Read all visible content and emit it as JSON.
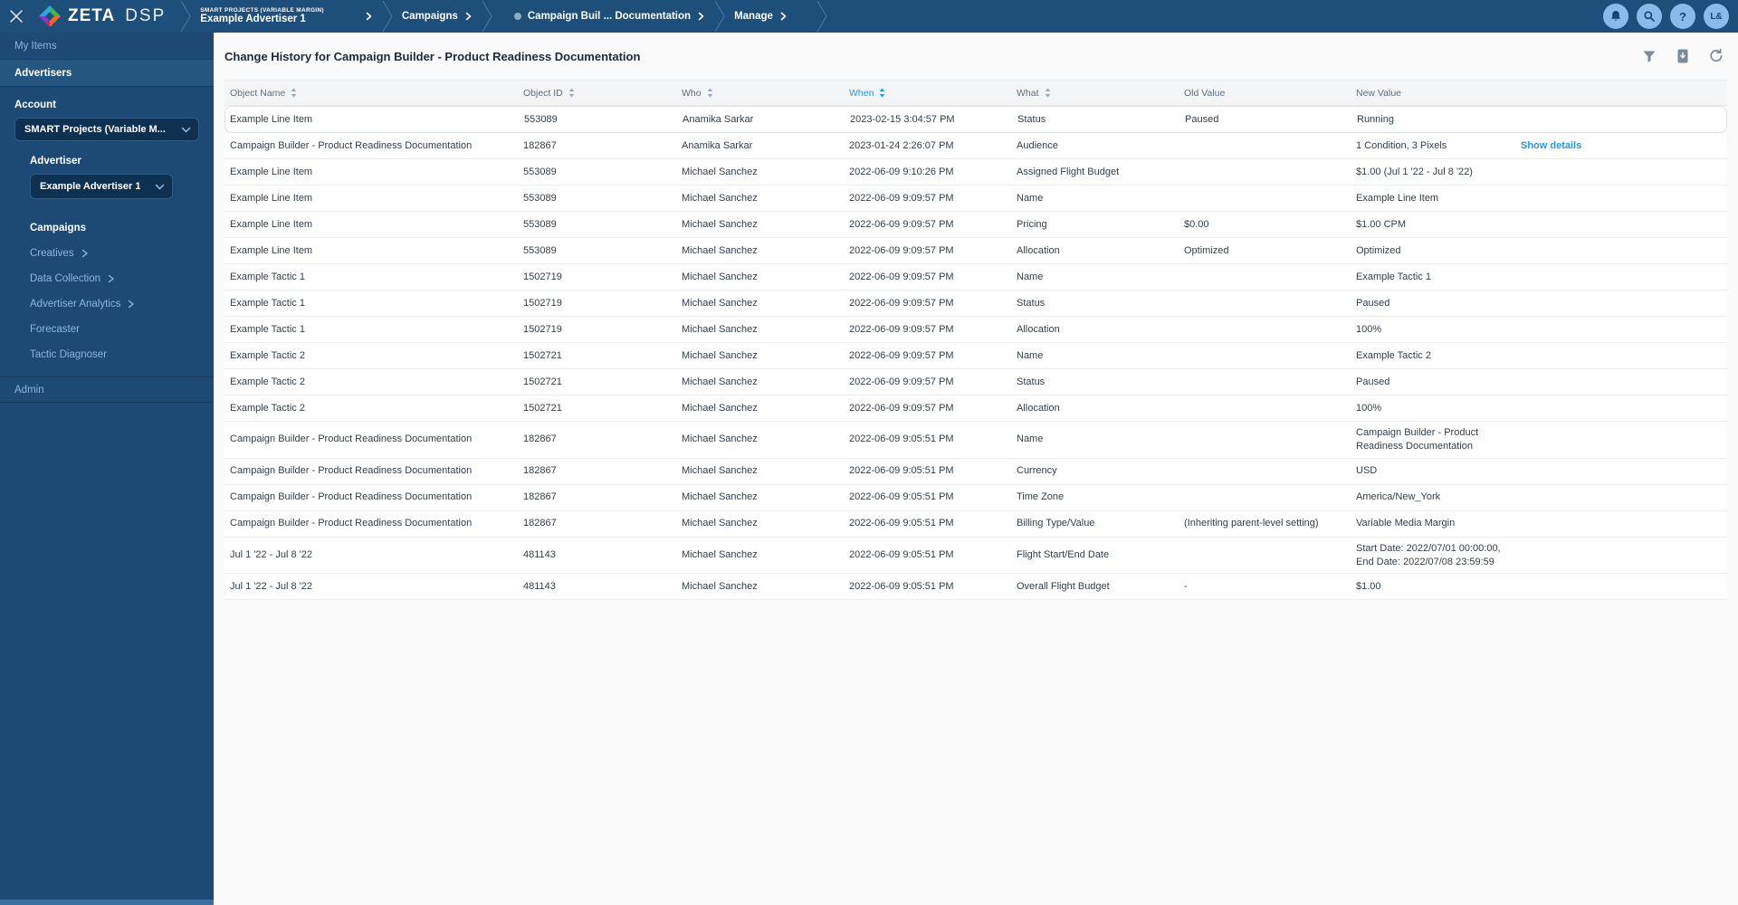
{
  "colors": {
    "accent": "#2196f3",
    "topbar": "#1e4e7a",
    "sidebar": "#1c4a75",
    "icon_gray": "#7d8b99",
    "circle_bg": "#8abae9"
  },
  "topbar": {
    "brand_zeta": "ZETA",
    "brand_dsp": "DSP",
    "breadcrumbs": {
      "account_small": "SMART PROJECTS (VARIABLE MARGIN)",
      "advertiser": "Example Advertiser 1",
      "campaigns": "Campaigns",
      "campaign": "Campaign Buil ... Documentation",
      "manage": "Manage"
    },
    "icons": [
      "bell-icon",
      "search-icon",
      "help-icon",
      "avatar"
    ],
    "avatar_initials": "L&"
  },
  "sidebar": {
    "my_items": "My Items",
    "advertisers": "Advertisers",
    "account_label": "Account",
    "account_value": "SMART Projects (Variable M...",
    "advertiser_label": "Advertiser",
    "advertiser_value": "Example Advertiser 1",
    "nav": [
      {
        "label": "Campaigns",
        "active": true,
        "arrow": false
      },
      {
        "label": "Creatives",
        "active": false,
        "arrow": true
      },
      {
        "label": "Data Collection",
        "active": false,
        "arrow": true
      },
      {
        "label": "Advertiser Analytics",
        "active": false,
        "arrow": true
      },
      {
        "label": "Forecaster",
        "active": false,
        "arrow": false
      },
      {
        "label": "Tactic Diagnoser",
        "active": false,
        "arrow": false
      }
    ],
    "admin": "Admin"
  },
  "main": {
    "title": "Change History for Campaign Builder - Product Readiness Documentation",
    "toolbar_icons": [
      "filter-icon",
      "export-icon",
      "refresh-icon"
    ],
    "table": {
      "columns": [
        {
          "key": "object_name",
          "label": "Object Name",
          "sortable": true,
          "active": false
        },
        {
          "key": "object_id",
          "label": "Object ID",
          "sortable": true,
          "active": false
        },
        {
          "key": "who",
          "label": "Who",
          "sortable": true,
          "active": false
        },
        {
          "key": "when",
          "label": "When",
          "sortable": true,
          "active": true
        },
        {
          "key": "what",
          "label": "What",
          "sortable": true,
          "active": false
        },
        {
          "key": "old_value",
          "label": "Old Value",
          "sortable": false,
          "active": false
        },
        {
          "key": "new_value",
          "label": "New Value",
          "sortable": false,
          "active": false
        }
      ],
      "details_link_label": "Show details",
      "rows": [
        {
          "object_name": "Example Line Item",
          "object_id": "553089",
          "who": "Anamika Sarkar",
          "when": "2023-02-15 3:04:57 PM",
          "what": "Status",
          "old_value": "Paused",
          "new_value": "Running",
          "details": false,
          "highlighted": true
        },
        {
          "object_name": "Campaign Builder - Product Readiness Documentation",
          "object_id": "182867",
          "who": "Anamika Sarkar",
          "when": "2023-01-24 2:26:07 PM",
          "what": "Audience",
          "old_value": "",
          "new_value": "1 Condition, 3 Pixels",
          "details": true,
          "highlighted": false
        },
        {
          "object_name": "Example Line Item",
          "object_id": "553089",
          "who": "Michael Sanchez",
          "when": "2022-06-09 9:10:26 PM",
          "what": "Assigned Flight Budget",
          "old_value": "",
          "new_value": "$1.00 (Jul 1 '22 - Jul 8 '22)",
          "details": false,
          "highlighted": false
        },
        {
          "object_name": "Example Line Item",
          "object_id": "553089",
          "who": "Michael Sanchez",
          "when": "2022-06-09 9:09:57 PM",
          "what": "Name",
          "old_value": "",
          "new_value": "Example Line Item",
          "details": false,
          "highlighted": false
        },
        {
          "object_name": "Example Line Item",
          "object_id": "553089",
          "who": "Michael Sanchez",
          "when": "2022-06-09 9:09:57 PM",
          "what": "Pricing",
          "old_value": "$0.00",
          "new_value": "$1.00 CPM",
          "details": false,
          "highlighted": false
        },
        {
          "object_name": "Example Line Item",
          "object_id": "553089",
          "who": "Michael Sanchez",
          "when": "2022-06-09 9:09:57 PM",
          "what": "Allocation",
          "old_value": "Optimized",
          "new_value": "Optimized",
          "details": false,
          "highlighted": false
        },
        {
          "object_name": "Example Tactic 1",
          "object_id": "1502719",
          "who": "Michael Sanchez",
          "when": "2022-06-09 9:09:57 PM",
          "what": "Name",
          "old_value": "",
          "new_value": "Example Tactic 1",
          "details": false,
          "highlighted": false
        },
        {
          "object_name": "Example Tactic 1",
          "object_id": "1502719",
          "who": "Michael Sanchez",
          "when": "2022-06-09 9:09:57 PM",
          "what": "Status",
          "old_value": "",
          "new_value": "Paused",
          "details": false,
          "highlighted": false
        },
        {
          "object_name": "Example Tactic 1",
          "object_id": "1502719",
          "who": "Michael Sanchez",
          "when": "2022-06-09 9:09:57 PM",
          "what": "Allocation",
          "old_value": "",
          "new_value": "100%",
          "details": false,
          "highlighted": false
        },
        {
          "object_name": "Example Tactic 2",
          "object_id": "1502721",
          "who": "Michael Sanchez",
          "when": "2022-06-09 9:09:57 PM",
          "what": "Name",
          "old_value": "",
          "new_value": "Example Tactic 2",
          "details": false,
          "highlighted": false
        },
        {
          "object_name": "Example Tactic 2",
          "object_id": "1502721",
          "who": "Michael Sanchez",
          "when": "2022-06-09 9:09:57 PM",
          "what": "Status",
          "old_value": "",
          "new_value": "Paused",
          "details": false,
          "highlighted": false
        },
        {
          "object_name": "Example Tactic 2",
          "object_id": "1502721",
          "who": "Michael Sanchez",
          "when": "2022-06-09 9:09:57 PM",
          "what": "Allocation",
          "old_value": "",
          "new_value": "100%",
          "details": false,
          "highlighted": false
        },
        {
          "object_name": "Campaign Builder - Product Readiness Documentation",
          "object_id": "182867",
          "who": "Michael Sanchez",
          "when": "2022-06-09 9:05:51 PM",
          "what": "Name",
          "old_value": "",
          "new_value": "Campaign Builder - Product Readiness Documentation",
          "details": false,
          "highlighted": false
        },
        {
          "object_name": "Campaign Builder - Product Readiness Documentation",
          "object_id": "182867",
          "who": "Michael Sanchez",
          "when": "2022-06-09 9:05:51 PM",
          "what": "Currency",
          "old_value": "",
          "new_value": "USD",
          "details": false,
          "highlighted": false
        },
        {
          "object_name": "Campaign Builder - Product Readiness Documentation",
          "object_id": "182867",
          "who": "Michael Sanchez",
          "when": "2022-06-09 9:05:51 PM",
          "what": "Time Zone",
          "old_value": "",
          "new_value": "America/New_York",
          "details": false,
          "highlighted": false
        },
        {
          "object_name": "Campaign Builder - Product Readiness Documentation",
          "object_id": "182867",
          "who": "Michael Sanchez",
          "when": "2022-06-09 9:05:51 PM",
          "what": "Billing Type/Value",
          "old_value": "(Inheriting parent-level setting)",
          "new_value": "Variable Media Margin",
          "details": false,
          "highlighted": false
        },
        {
          "object_name": "Jul 1 '22 - Jul 8 '22",
          "object_id": "481143",
          "who": "Michael Sanchez",
          "when": "2022-06-09 9:05:51 PM",
          "what": "Flight Start/End Date",
          "old_value": "",
          "new_value": "Start Date: 2022/07/01 00:00:00, End Date: 2022/07/08 23:59:59",
          "details": false,
          "highlighted": false
        },
        {
          "object_name": "Jul 1 '22 - Jul 8 '22",
          "object_id": "481143",
          "who": "Michael Sanchez",
          "when": "2022-06-09 9:05:51 PM",
          "what": "Overall Flight Budget",
          "old_value": "-",
          "new_value": "$1.00",
          "details": false,
          "highlighted": false
        }
      ]
    }
  }
}
